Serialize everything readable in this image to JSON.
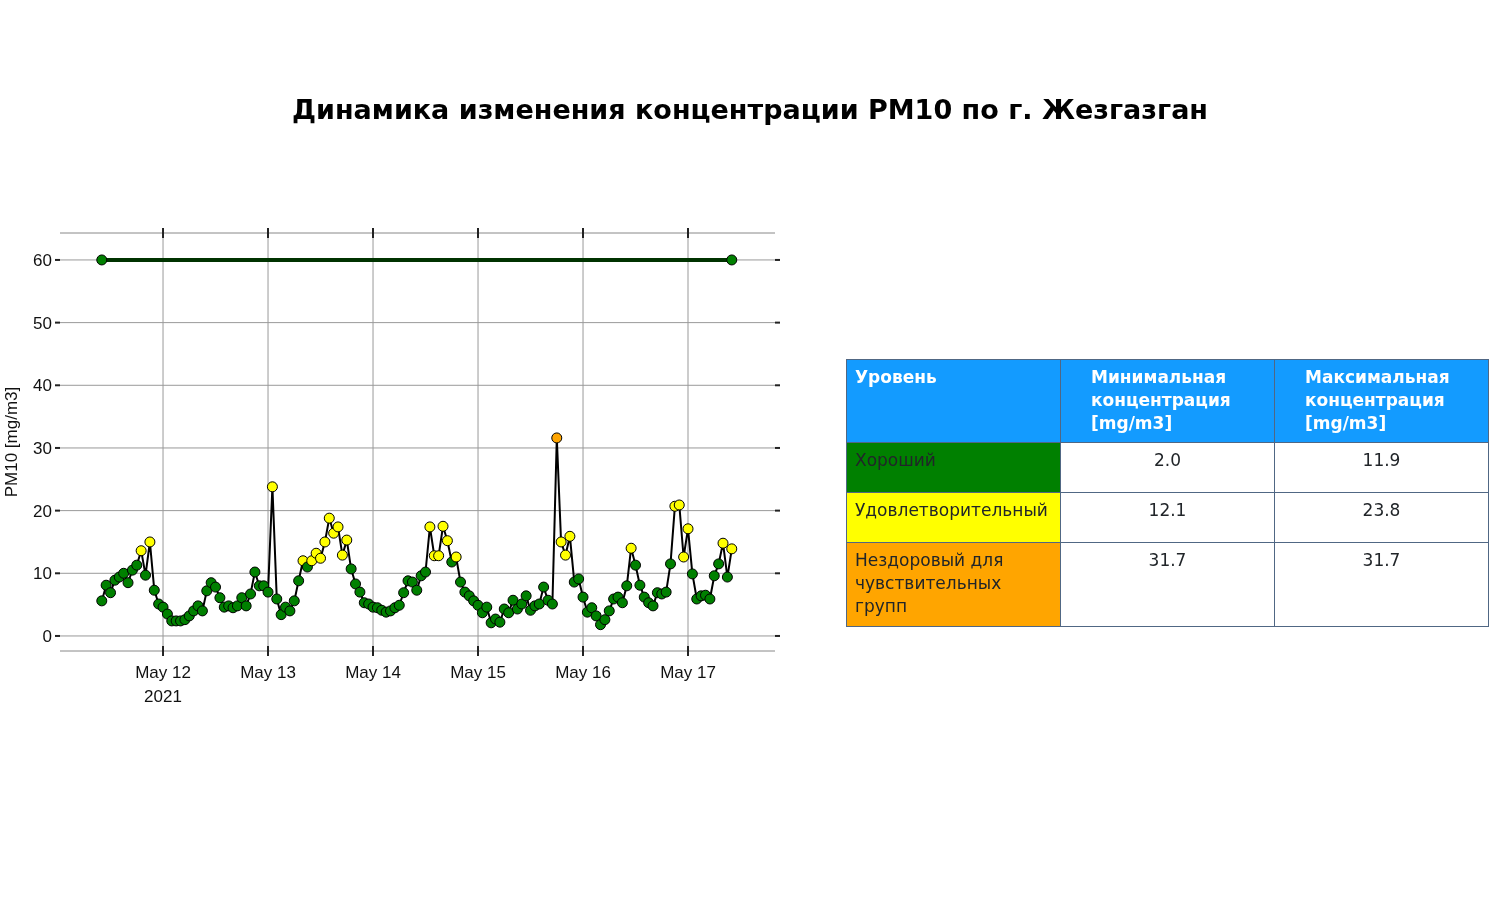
{
  "title": "Динамика изменения концентрации PM10 по г. Жезгазган",
  "chart": {
    "chart_data": {
      "type": "line",
      "grid": true,
      "ylabel": "PM10 [mg/m3]",
      "x": [
        "2021-05-11 10:00",
        "2021-05-11 11:00",
        "2021-05-11 12:00",
        "2021-05-11 13:00",
        "2021-05-11 14:00",
        "2021-05-11 15:00",
        "2021-05-11 16:00",
        "2021-05-11 17:00",
        "2021-05-11 18:00",
        "2021-05-11 19:00",
        "2021-05-11 20:00",
        "2021-05-11 21:00",
        "2021-05-11 22:00",
        "2021-05-11 23:00",
        "2021-05-12 00:00",
        "2021-05-12 01:00",
        "2021-05-12 02:00",
        "2021-05-12 03:00",
        "2021-05-12 04:00",
        "2021-05-12 05:00",
        "2021-05-12 06:00",
        "2021-05-12 07:00",
        "2021-05-12 08:00",
        "2021-05-12 09:00",
        "2021-05-12 10:00",
        "2021-05-12 11:00",
        "2021-05-12 12:00",
        "2021-05-12 13:00",
        "2021-05-12 14:00",
        "2021-05-12 15:00",
        "2021-05-12 16:00",
        "2021-05-12 17:00",
        "2021-05-12 18:00",
        "2021-05-12 19:00",
        "2021-05-12 20:00",
        "2021-05-12 21:00",
        "2021-05-12 22:00",
        "2021-05-12 23:00",
        "2021-05-13 00:00",
        "2021-05-13 01:00",
        "2021-05-13 02:00",
        "2021-05-13 03:00",
        "2021-05-13 04:00",
        "2021-05-13 05:00",
        "2021-05-13 06:00",
        "2021-05-13 07:00",
        "2021-05-13 08:00",
        "2021-05-13 09:00",
        "2021-05-13 10:00",
        "2021-05-13 11:00",
        "2021-05-13 12:00",
        "2021-05-13 13:00",
        "2021-05-13 14:00",
        "2021-05-13 15:00",
        "2021-05-13 16:00",
        "2021-05-13 17:00",
        "2021-05-13 18:00",
        "2021-05-13 19:00",
        "2021-05-13 20:00",
        "2021-05-13 21:00",
        "2021-05-13 22:00",
        "2021-05-13 23:00",
        "2021-05-14 00:00",
        "2021-05-14 01:00",
        "2021-05-14 02:00",
        "2021-05-14 03:00",
        "2021-05-14 04:00",
        "2021-05-14 05:00",
        "2021-05-14 06:00",
        "2021-05-14 07:00",
        "2021-05-14 08:00",
        "2021-05-14 09:00",
        "2021-05-14 10:00",
        "2021-05-14 11:00",
        "2021-05-14 12:00",
        "2021-05-14 13:00",
        "2021-05-14 14:00",
        "2021-05-14 15:00",
        "2021-05-14 16:00",
        "2021-05-14 17:00",
        "2021-05-14 18:00",
        "2021-05-14 19:00",
        "2021-05-14 20:00",
        "2021-05-14 21:00",
        "2021-05-14 22:00",
        "2021-05-14 23:00",
        "2021-05-15 00:00",
        "2021-05-15 01:00",
        "2021-05-15 02:00",
        "2021-05-15 03:00",
        "2021-05-15 04:00",
        "2021-05-15 05:00",
        "2021-05-15 06:00",
        "2021-05-15 07:00",
        "2021-05-15 08:00",
        "2021-05-15 09:00",
        "2021-05-15 10:00",
        "2021-05-15 11:00",
        "2021-05-15 12:00",
        "2021-05-15 13:00",
        "2021-05-15 14:00",
        "2021-05-15 15:00",
        "2021-05-15 16:00",
        "2021-05-15 17:00",
        "2021-05-15 18:00",
        "2021-05-15 19:00",
        "2021-05-15 20:00",
        "2021-05-15 21:00",
        "2021-05-15 22:00",
        "2021-05-15 23:00",
        "2021-05-16 00:00",
        "2021-05-16 01:00",
        "2021-05-16 02:00",
        "2021-05-16 03:00",
        "2021-05-16 04:00",
        "2021-05-16 05:00",
        "2021-05-16 06:00",
        "2021-05-16 07:00",
        "2021-05-16 08:00",
        "2021-05-16 09:00",
        "2021-05-16 10:00",
        "2021-05-16 11:00",
        "2021-05-16 12:00",
        "2021-05-16 13:00",
        "2021-05-16 14:00",
        "2021-05-16 15:00",
        "2021-05-16 16:00",
        "2021-05-16 17:00",
        "2021-05-16 18:00",
        "2021-05-16 19:00",
        "2021-05-16 20:00",
        "2021-05-16 21:00",
        "2021-05-16 22:00",
        "2021-05-16 23:00",
        "2021-05-17 00:00",
        "2021-05-17 01:00",
        "2021-05-17 02:00",
        "2021-05-17 03:00",
        "2021-05-17 04:00",
        "2021-05-17 05:00",
        "2021-05-17 06:00",
        "2021-05-17 07:00",
        "2021-05-17 08:00",
        "2021-05-17 09:00",
        "2021-05-17 10:00"
      ],
      "series": [
        {
          "color": "#000000",
          "marker": true,
          "values": [
            5.6,
            8.1,
            6.9,
            8.9,
            9.4,
            10.0,
            8.5,
            10.5,
            11.3,
            13.6,
            9.7,
            15.0,
            7.3,
            5.1,
            4.6,
            3.5,
            2.4,
            2.4,
            2.4,
            2.6,
            3.2,
            4.0,
            4.8,
            4.0,
            7.2,
            8.5,
            7.8,
            6.1,
            4.6,
            4.8,
            4.5,
            4.8,
            6.1,
            4.8,
            6.7,
            10.2,
            8.0,
            8.0,
            7.0,
            23.8,
            5.9,
            3.4,
            4.6,
            4.0,
            5.6,
            8.8,
            12.0,
            11.0,
            12.0,
            13.2,
            12.4,
            15.0,
            18.8,
            16.4,
            17.4,
            12.9,
            15.3,
            10.7,
            8.3,
            7.0,
            5.3,
            5.1,
            4.6,
            4.5,
            4.1,
            3.8,
            4.0,
            4.5,
            4.9,
            6.9,
            8.8,
            8.6,
            7.3,
            9.6,
            10.2,
            17.4,
            12.8,
            12.8,
            17.5,
            15.2,
            11.8,
            12.6,
            8.6,
            7.0,
            6.4,
            5.6,
            4.9,
            3.7,
            4.6,
            2.1,
            2.7,
            2.2,
            4.3,
            3.7,
            5.7,
            4.3,
            5.1,
            6.4,
            4.1,
            4.8,
            5.1,
            7.8,
            5.7,
            5.1,
            31.6,
            15.0,
            12.9,
            15.9,
            8.6,
            9.1,
            6.2,
            3.8,
            4.5,
            3.2,
            1.8,
            2.6,
            4.0,
            5.9,
            6.2,
            5.3,
            8.0,
            14.0,
            11.3,
            8.1,
            6.2,
            5.3,
            4.8,
            6.9,
            6.7,
            7.0,
            11.5,
            20.7,
            20.9,
            12.6,
            17.1,
            9.9,
            5.9,
            6.4,
            6.5,
            5.9,
            9.6,
            11.5,
            14.8,
            9.4,
            13.9
          ]
        },
        {
          "color": "#003300",
          "marker": true,
          "values": [
            60,
            null,
            null,
            null,
            null,
            null,
            null,
            null,
            null,
            null,
            null,
            null,
            null,
            null,
            null,
            null,
            null,
            null,
            null,
            null,
            null,
            null,
            null,
            null,
            null,
            null,
            null,
            null,
            null,
            null,
            null,
            null,
            null,
            null,
            null,
            null,
            null,
            null,
            null,
            null,
            null,
            null,
            null,
            null,
            null,
            null,
            null,
            null,
            null,
            null,
            null,
            null,
            null,
            null,
            null,
            null,
            null,
            null,
            null,
            null,
            null,
            null,
            null,
            null,
            null,
            null,
            null,
            null,
            null,
            null,
            null,
            null,
            null,
            null,
            null,
            null,
            null,
            null,
            null,
            null,
            null,
            null,
            null,
            null,
            null,
            null,
            null,
            null,
            null,
            null,
            null,
            null,
            null,
            null,
            null,
            null,
            null,
            null,
            null,
            null,
            null,
            null,
            null,
            null,
            null,
            null,
            null,
            null,
            null,
            null,
            null,
            null,
            null,
            null,
            null,
            null,
            null,
            null,
            null,
            null,
            null,
            null,
            null,
            null,
            null,
            null,
            null,
            null,
            null,
            null,
            null,
            null,
            null,
            null,
            null,
            null,
            null,
            null,
            null,
            null,
            null,
            null,
            null,
            null,
            60
          ]
        }
      ],
      "xlim": [
        "2021-05-11 00:27",
        "2021-05-17 19:53"
      ],
      "ylim": [
        -2.4,
        64.3
      ],
      "xticks": [
        {
          "value": "2021-05-12 00:00",
          "label": "May 12\n2021"
        },
        {
          "value": "2021-05-13 00:00",
          "label": "May 13"
        },
        {
          "value": "2021-05-14 00:00",
          "label": "May 14"
        },
        {
          "value": "2021-05-15 00:00",
          "label": "May 15"
        },
        {
          "value": "2021-05-16 00:00",
          "label": "May 16"
        },
        {
          "value": "2021-05-17 00:00",
          "label": "May 17"
        }
      ],
      "yticks": [
        0,
        10,
        20,
        30,
        40,
        50,
        60
      ]
    }
  },
  "table": {
    "columns": [
      "Уровень",
      "Минимальная\n концентрация\n[mg/m3]",
      "Максимальная\nконцентрация\n[mg/m3]"
    ],
    "rows": [
      {
        "level": "Хороший",
        "color": "#008000",
        "min": "2.0",
        "max": "11.9"
      },
      {
        "level": "Удовлетворительный",
        "color": "#ffff00",
        "min": "12.1",
        "max": "23.8"
      },
      {
        "level": "Нездоровый для\nчувствительных\nгрупп",
        "color": "#ffa500",
        "min": "31.7",
        "max": "31.7"
      }
    ]
  }
}
